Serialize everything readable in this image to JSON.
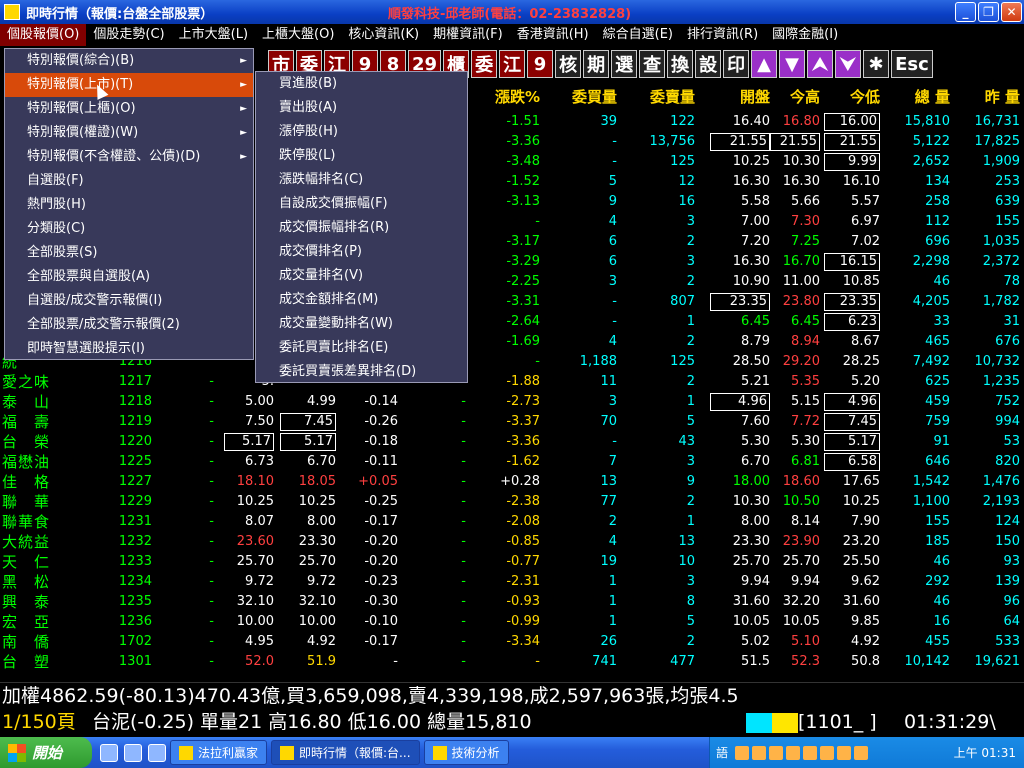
{
  "window": {
    "title": "即時行情（報價:台盤全部股票）",
    "title_right": "順發科技-邱老師(電話：02-23832828)"
  },
  "menubar": [
    "個股報價(O)",
    "個股走勢(C)",
    "上市大盤(L)",
    "上櫃大盤(O)",
    "核心資訊(K)",
    "期權資訊(F)",
    "香港資訊(H)",
    "綜合自選(E)",
    "排行資訊(R)",
    "國際金融(I)"
  ],
  "toolbar": [
    "市",
    "委",
    "江",
    "9",
    "8",
    "29",
    "櫃",
    "委",
    "江",
    "9",
    "核",
    "期",
    "選",
    "查",
    "換",
    "設",
    "印",
    "▲",
    "▼",
    "⮝",
    "⮟",
    "✱",
    "Esc"
  ],
  "menu1": [
    {
      "label": "特別報價(綜合)(B)",
      "arrow": true
    },
    {
      "label": "特別報價(上市)(T)",
      "arrow": true,
      "selected": true
    },
    {
      "label": "特別報價(上櫃)(O)",
      "arrow": true
    },
    {
      "label": "特別報價(權證)(W)",
      "arrow": true
    },
    {
      "label": "特別報價(不含權證、公債)(D)",
      "arrow": true
    },
    {
      "label": "自選股(F)"
    },
    {
      "label": "熱門股(H)"
    },
    {
      "label": "分類股(C)"
    },
    {
      "label": "全部股票(S)"
    },
    {
      "label": "全部股票與自選股(A)"
    },
    {
      "label": "自選股/成交警示報價(I)"
    },
    {
      "label": "全部股票/成交警示報價(2)"
    },
    {
      "label": "即時智慧選股提示(I)"
    }
  ],
  "menu2": [
    "買進股(B)",
    "賣出股(A)",
    "漲停股(H)",
    "跌停股(L)",
    "漲跌幅排名(C)",
    "自設成交價振幅(F)",
    "成交價振幅排名(R)",
    "成交價排名(P)",
    "成交量排名(V)",
    "成交金額排名(M)",
    "成交量變動排名(W)",
    "委託買賣比排名(E)",
    "委託買賣張差異排名(D)"
  ],
  "headers": [
    "漲跌%",
    "委買量",
    "委賣量",
    "開盤",
    "今高",
    "今低",
    "總 量",
    "昨 量"
  ],
  "rows_top": [
    [
      "-1.51",
      "39",
      "122",
      "16.40",
      "16.80",
      "16.00",
      "15,810",
      "16,731"
    ],
    [
      "-3.36",
      "-",
      "13,756",
      "21.55",
      "21.55",
      "21.55",
      "5,122",
      "17,825"
    ],
    [
      "-3.48",
      "-",
      "125",
      "10.25",
      "10.30",
      "9.99",
      "2,652",
      "1,909"
    ],
    [
      "-1.52",
      "5",
      "12",
      "16.30",
      "16.30",
      "16.10",
      "134",
      "253"
    ],
    [
      "-3.13",
      "9",
      "16",
      "5.58",
      "5.66",
      "5.57",
      "258",
      "639"
    ],
    [
      "-",
      "4",
      "3",
      "7.00",
      "7.30",
      "6.97",
      "112",
      "155"
    ],
    [
      "-3.17",
      "6",
      "2",
      "7.20",
      "7.25",
      "7.02",
      "696",
      "1,035"
    ],
    [
      "-3.29",
      "6",
      "3",
      "16.30",
      "16.70",
      "16.15",
      "2,298",
      "2,372"
    ],
    [
      "-2.25",
      "3",
      "2",
      "10.90",
      "11.00",
      "10.85",
      "46",
      "78"
    ],
    [
      "-3.31",
      "-",
      "807",
      "23.35",
      "23.80",
      "23.35",
      "4,205",
      "1,782"
    ],
    [
      "-2.64",
      "-",
      "1",
      "6.45",
      "6.45",
      "6.23",
      "33",
      "31"
    ],
    [
      "-1.69",
      "4",
      "2",
      "8.79",
      "8.94",
      "8.67",
      "465",
      "676"
    ],
    [
      "-",
      "1,188",
      "125",
      "28.50",
      "29.20",
      "28.25",
      "7,492",
      "10,732"
    ]
  ],
  "rows_full": [
    [
      "愛之味",
      "1217",
      "-",
      "5.",
      "",
      "",
      "",
      "-1.88",
      "11",
      "2",
      "5.21",
      "5.35",
      "5.20",
      "625",
      "1,235"
    ],
    [
      "泰　山",
      "1218",
      "-",
      "5.00",
      "4.99",
      "-0.14",
      "-",
      "-2.73",
      "3",
      "1",
      "4.96",
      "5.15",
      "4.96",
      "459",
      "752"
    ],
    [
      "福　壽",
      "1219",
      "-",
      "7.50",
      "7.45",
      "-0.26",
      "-",
      "-3.37",
      "70",
      "5",
      "7.60",
      "7.72",
      "7.45",
      "759",
      "994"
    ],
    [
      "台　榮",
      "1220",
      "-",
      "5.17",
      "5.17",
      "-0.18",
      "-",
      "-3.36",
      "-",
      "43",
      "5.30",
      "5.30",
      "5.17",
      "91",
      "53"
    ],
    [
      "福懋油",
      "1225",
      "-",
      "6.73",
      "6.70",
      "-0.11",
      "-",
      "-1.62",
      "7",
      "3",
      "6.70",
      "6.81",
      "6.58",
      "646",
      "820"
    ],
    [
      "佳　格",
      "1227",
      "-",
      "18.10",
      "18.05",
      "+0.05",
      "-",
      "+0.28",
      "13",
      "9",
      "18.00",
      "18.60",
      "17.65",
      "1,542",
      "1,476"
    ],
    [
      "聯　華",
      "1229",
      "-",
      "10.25",
      "10.25",
      "-0.25",
      "-",
      "-2.38",
      "77",
      "2",
      "10.30",
      "10.50",
      "10.25",
      "1,100",
      "2,193"
    ],
    [
      "聯華食",
      "1231",
      "-",
      "8.07",
      "8.00",
      "-0.17",
      "-",
      "-2.08",
      "2",
      "1",
      "8.00",
      "8.14",
      "7.90",
      "155",
      "124"
    ],
    [
      "大統益",
      "1232",
      "-",
      "23.60",
      "23.30",
      "-0.20",
      "-",
      "-0.85",
      "4",
      "13",
      "23.30",
      "23.90",
      "23.20",
      "185",
      "150"
    ],
    [
      "天　仁",
      "1233",
      "-",
      "25.70",
      "25.70",
      "-0.20",
      "-",
      "-0.77",
      "19",
      "10",
      "25.70",
      "25.70",
      "25.50",
      "46",
      "93"
    ],
    [
      "黑　松",
      "1234",
      "-",
      "9.72",
      "9.72",
      "-0.23",
      "-",
      "-2.31",
      "1",
      "3",
      "9.94",
      "9.94",
      "9.62",
      "292",
      "139"
    ],
    [
      "興　泰",
      "1235",
      "-",
      "32.10",
      "32.10",
      "-0.30",
      "-",
      "-0.93",
      "1",
      "8",
      "31.60",
      "32.20",
      "31.60",
      "46",
      "96"
    ],
    [
      "宏　亞",
      "1236",
      "-",
      "10.00",
      "10.00",
      "-0.10",
      "-",
      "-0.99",
      "1",
      "5",
      "10.05",
      "10.05",
      "9.85",
      "16",
      "64"
    ],
    [
      "南　僑",
      "1702",
      "-",
      "4.95",
      "4.92",
      "-0.17",
      "-",
      "-3.34",
      "26",
      "2",
      "5.02",
      "5.10",
      "4.92",
      "455",
      "533"
    ],
    [
      "台　塑",
      "1301",
      "-",
      "52.0",
      "51.9",
      "-",
      "-",
      "-",
      "741",
      "477",
      "51.5",
      "52.3",
      "50.8",
      "10,142",
      "19,621"
    ]
  ],
  "row12_name": "統",
  "row12_code": "1216",
  "status1": "加權4862.59(-80.13)470.43億,買3,659,098,賣4,339,198,成2,597,963張,均張4.5",
  "status2": {
    "page": "1/150頁",
    "text": "台泥(-0.25) 單量21 高16.80 低16.00 總量15,810",
    "code": "[1101_  ]",
    "time": "01:31:29\\"
  },
  "taskbar": {
    "start": "開始",
    "tasks": [
      "法拉利贏家",
      "即時行情（報價:台...",
      "技術分析"
    ],
    "lang": "語",
    "clock": "上午 01:31"
  }
}
